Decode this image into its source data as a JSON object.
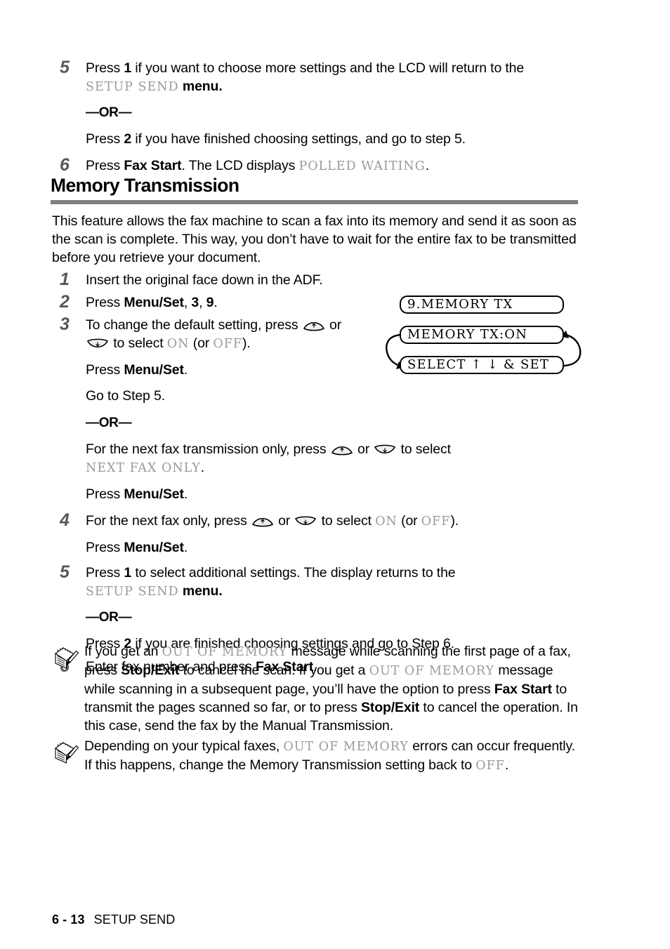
{
  "document": {
    "footer": {
      "page_number": "6 - 13",
      "section": "SETUP SEND"
    }
  },
  "top_steps": [
    {
      "number": "5",
      "lines": {
        "l1_a": "Press ",
        "l1_b": "1",
        "l1_c": " if you want to choose more settings and the LCD will return to the",
        "l2_mono": "SETUP SEND",
        "l2_after": " menu.",
        "or": "—OR—",
        "l3_a": "Press ",
        "l3_b": "2",
        "l3_c": " if you have finished choosing settings, and go to step 5."
      }
    },
    {
      "number": "6",
      "lines": {
        "l1_a": "Press ",
        "l1_b": "Fax Start",
        "l1_c": ". The LCD displays ",
        "l1_mono": "POLLED WAITING",
        "l1_d": "."
      }
    }
  ],
  "section": {
    "heading": "Memory Transmission",
    "intro": "This feature allows the fax machine to scan a fax into its memory and send it as soon as the scan is complete. This way, you don’t have to wait for the entire fax to be transmitted before you retrieve your document."
  },
  "lcd_diagram": {
    "box1": "9.MEMORY TX",
    "box2": "MEMORY TX:ON",
    "box3": "SELECT ↑ ↓ & SET"
  },
  "main_steps": {
    "s1": {
      "number": "1",
      "text": "Insert the original face down in the ADF."
    },
    "s2": {
      "number": "2",
      "a": "Press ",
      "b": "Menu/Set",
      "c": ", ",
      "d": "3",
      "e": ", ",
      "f": "9",
      "g": "."
    },
    "s3": {
      "number": "3",
      "l1_a": "To change the default setting, press ",
      "l1_or": " or ",
      "l2_a": " to select ",
      "l2_on": "ON",
      "l2_b": " (or ",
      "l2_off": "OFF",
      "l2_c": ").",
      "press_a": "Press ",
      "press_b": "Menu/Set",
      "press_c": ".",
      "goto": "Go to Step 5.",
      "or": "—OR—",
      "alt_l1_a": "For the next fax transmission only, press ",
      "alt_l1_or": " or ",
      "alt_l1_b": " to select",
      "alt_l2_mono": "NEXT FAX ONLY",
      "alt_l2_end": ".",
      "alt_press_a": "Press ",
      "alt_press_b": "Menu/Set",
      "alt_press_c": "."
    },
    "s4": {
      "number": "4",
      "l1_a": "For the next fax only, press ",
      "l1_or": " or ",
      "l1_b": " to select ",
      "l1_on": "ON",
      "l1_c": " (or ",
      "l1_off": "OFF",
      "l1_d": ").",
      "press_a": "Press ",
      "press_b": "Menu/Set",
      "press_c": "."
    },
    "s5": {
      "number": "5",
      "l1_a": "Press ",
      "l1_b": "1",
      "l1_c": " to select additional settings. The display returns to the",
      "l2_mono": "SETUP SEND",
      "l2_after": " menu.",
      "or": "—OR—",
      "l3_a": "Press ",
      "l3_b": "2",
      "l3_c": " if you are finished choosing settings and go to Step 6."
    },
    "s6": {
      "number": "6",
      "a": "Enter fax number and press ",
      "b": "Fax Start",
      "c": "."
    }
  },
  "notes": [
    {
      "p1": "If you get an ",
      "m1": "OUT OF MEMORY",
      "p2": " message while scanning the first page of a fax, press ",
      "b1": "Stop/Exit",
      "p3": " to cancel the scan. If you get a ",
      "m2": "OUT OF MEMORY",
      "p4": " message while scanning in a subsequent page, you’ll have the option to press ",
      "b2": "Fax Start",
      "p5": " to transmit the pages scanned so far, or to press ",
      "b3": "Stop/Exit",
      "p6": " to cancel the operation. In this case, send the fax by the Manual Transmission."
    },
    {
      "p1": "Depending on your typical faxes, ",
      "m1": "OUT OF MEMORY",
      "p2": " errors can occur frequently. If this happens, change the Memory Transmission setting back to ",
      "m2": "OFF",
      "p3": "."
    }
  ],
  "colors": {
    "rule": "#808080",
    "step_number": "#58585a",
    "lcd_mono": "#9a9a9a"
  }
}
